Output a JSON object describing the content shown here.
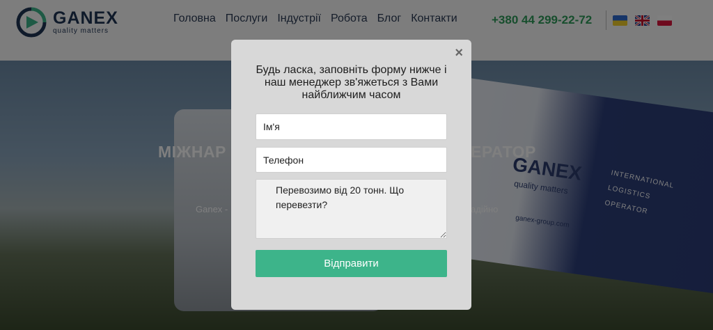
{
  "header": {
    "logo_name": "GANEX",
    "logo_tagline": "quality matters",
    "nav": [
      "Головна",
      "Послуги",
      "Індустрії",
      "Робота",
      "Блог",
      "Контакти"
    ],
    "phone": "+380 44 299-22-72",
    "languages": [
      "ua-flag-icon",
      "uk-flag-icon",
      "pl-flag-icon"
    ]
  },
  "hero": {
    "title_left": "МІЖНАР",
    "title_right": "ЕРАТОР",
    "subtitle_left": "Ganex -",
    "subtitle_right": "адійно",
    "truck_brand": "GANEX",
    "truck_tagline": "quality matters",
    "truck_side_lines": [
      "INTERNATIONAL",
      "LOGISTICS",
      "OPERATOR"
    ],
    "truck_url": "ganex-group.com"
  },
  "modal": {
    "close_glyph": "×",
    "title": "Будь ласка, заповніть форму нижче і наш менеджер зв'яжеться з Вами найближчим часом",
    "name_placeholder": "Ім'я",
    "phone_placeholder": "Телефон",
    "message_placeholder": "Перевозимо від 20 тонн. Що перевезти?",
    "submit_label": "Відправити"
  },
  "colors": {
    "accent_green": "#3db48a",
    "phone_green": "#2f9d5b",
    "brand_navy": "#1f3454",
    "modal_bg": "#d8d8d8"
  }
}
